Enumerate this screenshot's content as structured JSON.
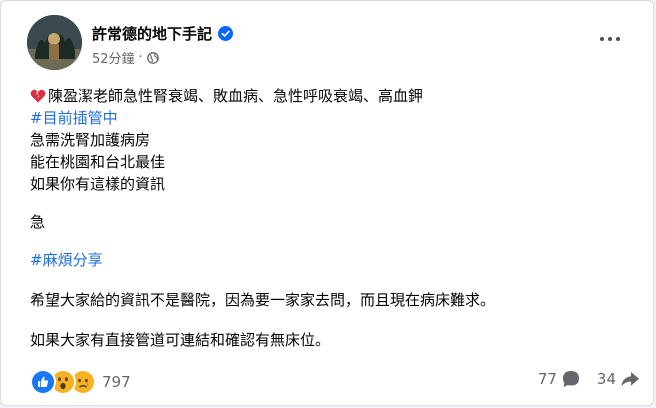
{
  "post": {
    "author": "許常德的地下手記",
    "time": "52分鐘",
    "separator": "·",
    "lines": {
      "l1": "陳盈潔老師急性腎衰竭、敗血病、急性呼吸衰竭、高血鉀",
      "l2": "#目前插管中",
      "l3": "急需洗腎加護病房",
      "l4": "能在桃園和台北最佳",
      "l5": "如果你有這樣的資訊",
      "l6": "急",
      "l7": "#麻煩分享",
      "l8": "希望大家給的資訊不是醫院，因為要一家家去問，而且現在病床難求。",
      "l9": "如果大家有直接管道可連結和確認有無床位。"
    }
  },
  "footer": {
    "reaction_count": "797",
    "comment_count": "77",
    "share_count": "34"
  },
  "colors": {
    "hashtag": "#216fdb",
    "verified": "#0866ff",
    "meta_text": "#65676b"
  },
  "icons": {
    "verified": "verified-badge-icon",
    "globe": "globe-icon",
    "broken_heart": "broken-heart-emoji",
    "reactions": [
      "like-reaction-icon",
      "wow-reaction-icon",
      "sad-reaction-icon"
    ],
    "comment": "comment-bubble-icon",
    "share": "share-arrow-icon"
  }
}
